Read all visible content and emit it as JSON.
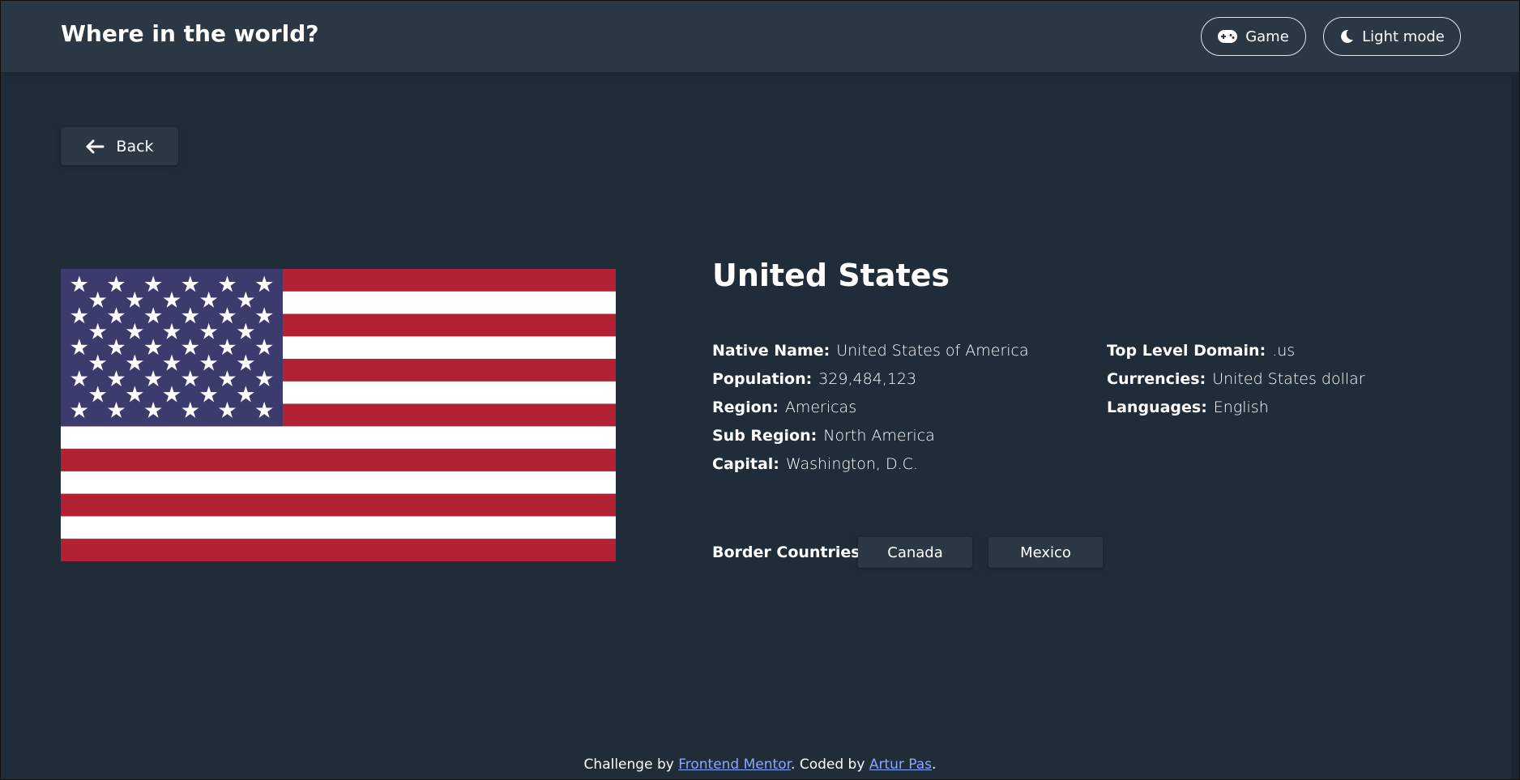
{
  "header": {
    "title": "Where in the world?",
    "game_label": "Game",
    "mode_label": "Light mode"
  },
  "back_label": "Back",
  "country": {
    "name": "United States",
    "flag_colors": {
      "red": "#b22234",
      "white": "#ffffff",
      "blue": "#3c3b6e"
    },
    "details_left": [
      {
        "label": "Native Name:",
        "value": "United States of America"
      },
      {
        "label": "Population:",
        "value": "329,484,123"
      },
      {
        "label": "Region:",
        "value": "Americas"
      },
      {
        "label": "Sub Region:",
        "value": "North America"
      },
      {
        "label": "Capital:",
        "value": "Washington, D.C."
      }
    ],
    "details_right": [
      {
        "label": "Top Level Domain:",
        "value": ".us"
      },
      {
        "label": "Currencies:",
        "value": "United States dollar"
      },
      {
        "label": "Languages:",
        "value": "English"
      }
    ],
    "border_label": "Border Countries:",
    "borders": [
      "Canada",
      "Mexico"
    ]
  },
  "footer": {
    "prefix": "Challenge by ",
    "link1": "Frontend Mentor",
    "middle": ". Coded by ",
    "link2": "Artur Pas",
    "suffix": "."
  },
  "colors": {
    "background": "#202c37",
    "elements": "#2b3743",
    "link": "#8aa6ff"
  }
}
